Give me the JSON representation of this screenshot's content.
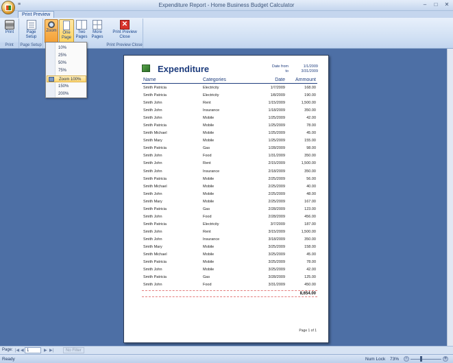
{
  "window": {
    "title": "Expenditure Report - Home Business Budget Calculator",
    "qat_glyph": "≡"
  },
  "tabs": [
    {
      "label": "Print Preview"
    }
  ],
  "ribbon": {
    "print": "Print",
    "page_setup": "Page Setup",
    "zoom": "Zoom",
    "one_page": "One Page",
    "two_pages": "Two Pages",
    "more_pages": "More Pages",
    "print_preview_close": "Print Preview Close",
    "groups": {
      "print": "Print",
      "page_setup": "Page Setup",
      "print_preview_close": "Print Preview Close"
    }
  },
  "zoom_menu": {
    "items": [
      "10%",
      "25%",
      "50%",
      "75%",
      "Zoom 100%",
      "150%",
      "200%"
    ],
    "checked_index": 4
  },
  "report": {
    "title": "Expenditure",
    "date_from_label": "Date from",
    "to_label": "to",
    "date_from": "1/1/2009",
    "date_to": "3/31/2009",
    "headers": {
      "name": "Name",
      "category": "Categories",
      "date": "Date",
      "amount": "Ammount"
    },
    "rows": [
      [
        "Smith Patricia",
        "Electricity",
        "1/7/2009",
        "168.00"
      ],
      [
        "Smith Patricia",
        "Electricity",
        "1/8/2009",
        "190.00"
      ],
      [
        "Smith John",
        "Rent",
        "1/15/2009",
        "1,500.00"
      ],
      [
        "Smith John",
        "Insurance",
        "1/18/2009",
        "350.00"
      ],
      [
        "Smith John",
        "Mobile",
        "1/25/2009",
        "42.00"
      ],
      [
        "Smith Patricia",
        "Mobile",
        "1/25/2009",
        "78.00"
      ],
      [
        "Smith Michael",
        "Mobile",
        "1/25/2009",
        "45.00"
      ],
      [
        "Smith Mary",
        "Mobile",
        "1/25/2009",
        "155.00"
      ],
      [
        "Smith Patricia",
        "Gas",
        "1/28/2009",
        "98.00"
      ],
      [
        "Smith John",
        "Food",
        "1/31/2009",
        "350.00"
      ],
      [
        "Smith John",
        "Rent",
        "2/15/2009",
        "1,500.00"
      ],
      [
        "Smith John",
        "Insurance",
        "2/18/2009",
        "350.00"
      ],
      [
        "Smith Patricia",
        "Mobile",
        "2/25/2009",
        "56.00"
      ],
      [
        "Smith Michael",
        "Mobile",
        "2/25/2009",
        "40.00"
      ],
      [
        "Smith John",
        "Mobile",
        "2/25/2009",
        "48.00"
      ],
      [
        "Smith Mary",
        "Mobile",
        "2/25/2009",
        "167.00"
      ],
      [
        "Smith Patricia",
        "Gas",
        "2/28/2009",
        "123.00"
      ],
      [
        "Smith John",
        "Food",
        "2/28/2009",
        "456.00"
      ],
      [
        "Smith Patricia",
        "Electricity",
        "3/7/2009",
        "187.00"
      ],
      [
        "Smith John",
        "Rent",
        "3/15/2009",
        "1,500.00"
      ],
      [
        "Smith John",
        "Insurance",
        "3/18/2009",
        "350.00"
      ],
      [
        "Smith Mary",
        "Mobile",
        "3/25/2009",
        "158.00"
      ],
      [
        "Smith Michael",
        "Mobile",
        "3/25/2009",
        "45.00"
      ],
      [
        "Smith Patricia",
        "Mobile",
        "3/25/2009",
        "78.00"
      ],
      [
        "Smith John",
        "Mobile",
        "3/25/2009",
        "42.00"
      ],
      [
        "Smith Patricia",
        "Gas",
        "3/28/2009",
        "125.00"
      ],
      [
        "Smith John",
        "Food",
        "3/31/2009",
        "450.00"
      ]
    ],
    "total": "8,654.00",
    "page_footer": "Page 1 of 1"
  },
  "nav": {
    "page_label": "Page:",
    "page_value": "1",
    "filter_label": "No Filter"
  },
  "status": {
    "ready": "Ready",
    "num_lock": "Num Lock",
    "zoom": "73%",
    "zoom_level": 0.73
  }
}
